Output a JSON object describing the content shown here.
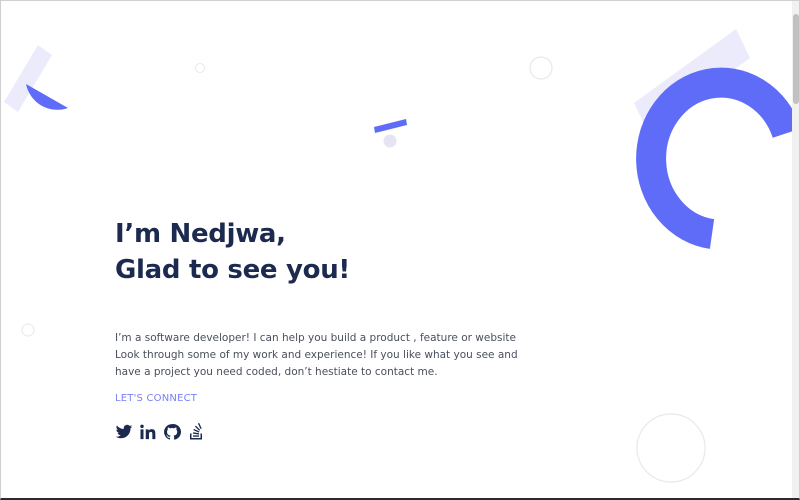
{
  "hero": {
    "heading_line1": "I’m Nedjwa,",
    "heading_line2": "Glad to see you!",
    "intro": "I’m a software developer! I can help you build a product , feature or website Look through some of my work and experience! If you like what you see and have a project you need coded, don’t hestiate to contact me.",
    "cta_label": "LET'S CONNECT"
  },
  "socials": [
    {
      "icon": "twitter-icon"
    },
    {
      "icon": "linkedin-icon"
    },
    {
      "icon": "github-icon"
    },
    {
      "icon": "stackoverflow-icon"
    }
  ],
  "colors": {
    "accent": "#5f6cf7",
    "accent_light": "#ebebfb",
    "heading": "#1b2a4e",
    "link": "#7a80f5"
  }
}
